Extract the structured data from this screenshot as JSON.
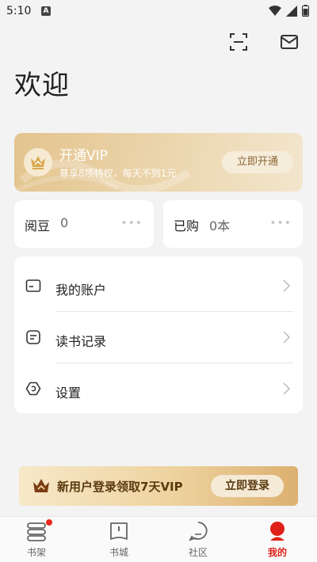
{
  "status_bar": {
    "time": "5:10",
    "notification_badge": "A"
  },
  "header": {
    "scan_icon": "scan-icon",
    "mail_icon": "mail-icon"
  },
  "welcome": "欢迎",
  "vip_card": {
    "title": "开通VIP",
    "subtitle": "尊享8项特权，每天不到1元",
    "button": "立即开通",
    "icon": "crown-icon",
    "colors": {
      "gradient_start": "#e3c48e",
      "gradient_end": "#f3e6cd"
    }
  },
  "stats": [
    {
      "label": "阅豆",
      "value": "0",
      "more": "•••"
    },
    {
      "label": "已购",
      "value": "0本",
      "more": "•••"
    }
  ],
  "menu": [
    {
      "label": "我的账户",
      "icon": "wallet-icon"
    },
    {
      "label": "读书记录",
      "icon": "reading-record-icon"
    },
    {
      "label": "设置",
      "icon": "hexagon-settings-icon"
    }
  ],
  "login_banner": {
    "text": "新用户登录领取7天VIP",
    "button": "立即登录",
    "icon": "crown-icon"
  },
  "tab_bar": {
    "tabs": [
      {
        "label": "书架",
        "icon": "bookshelf-icon",
        "badge": true
      },
      {
        "label": "书城",
        "icon": "book-store-icon"
      },
      {
        "label": "社区",
        "icon": "community-chat-icon"
      },
      {
        "label": "我的",
        "icon": "profile-icon",
        "active": true
      }
    ],
    "active_color": "#e0211a"
  }
}
